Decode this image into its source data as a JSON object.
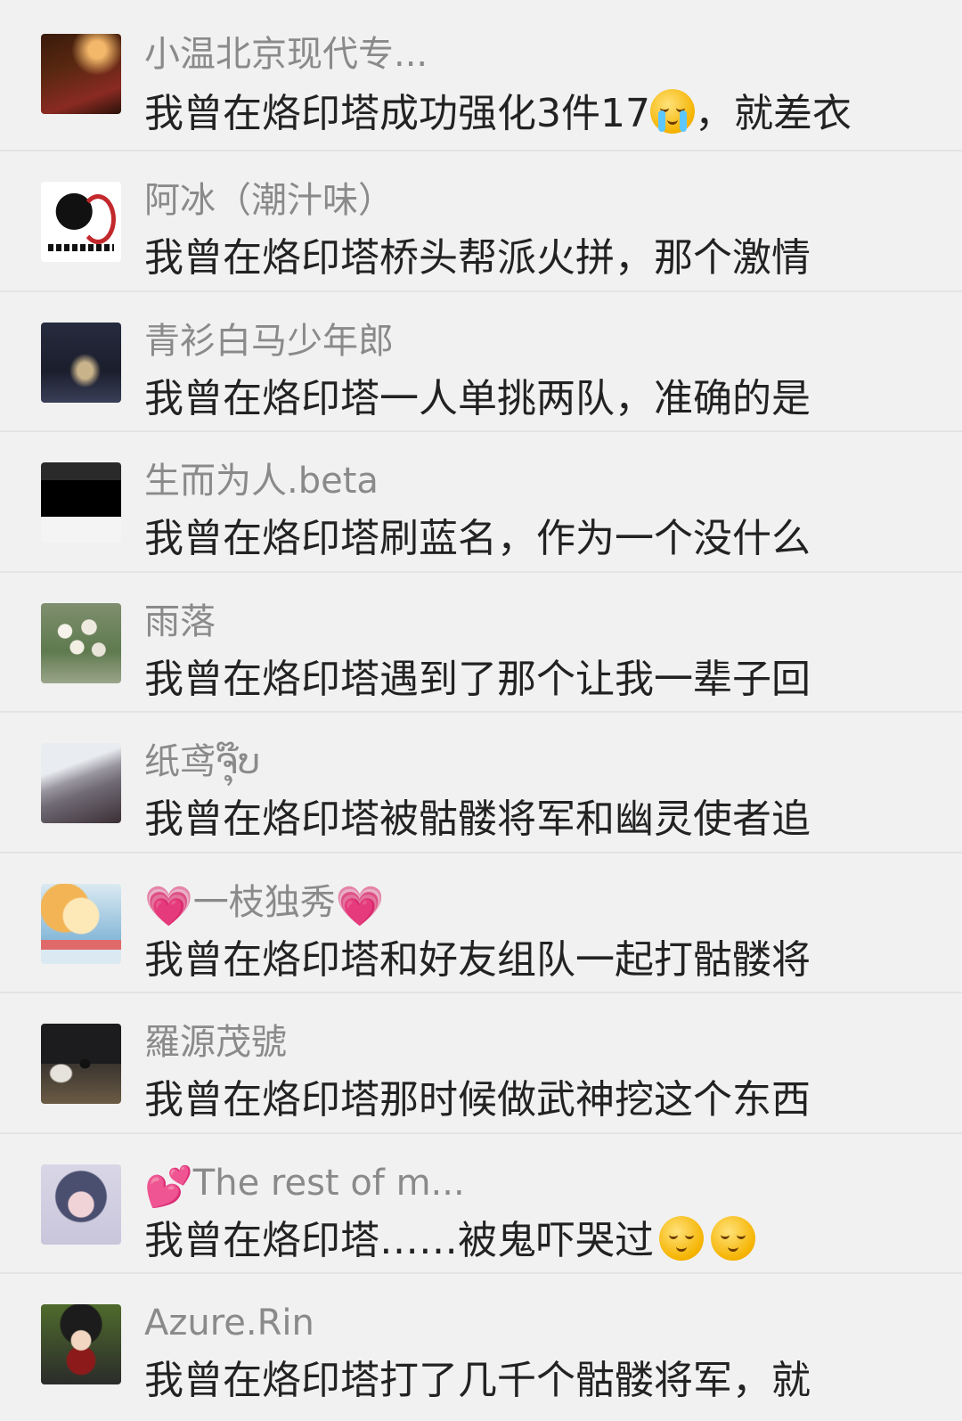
{
  "comments": [
    {
      "name": "小温北京现代专...",
      "message": "我曾在烙印塔成功强化3件17",
      "message_tail": "，就差衣",
      "avatar_colors": [
        "#5a2810",
        "#c8742c",
        "#8a2a22"
      ]
    },
    {
      "name": "阿冰（潮汁味）",
      "message": "我曾在烙印塔桥头帮派火拼，那个激情",
      "avatar_colors": [
        "#ffffff",
        "#c2282c",
        "#111111"
      ]
    },
    {
      "name": "青衫白马少年郎",
      "message": "我曾在烙印塔一人单挑两队，准确的是",
      "avatar_colors": [
        "#1b1e2c",
        "#3a3f58",
        "#b8a27a"
      ]
    },
    {
      "name": "生而为人.beta",
      "message": "我曾在烙印塔刷蓝名，作为一个没什么",
      "avatar_colors": [
        "#f4f4f4",
        "#000000",
        "#2a2a2a"
      ]
    },
    {
      "name": "雨落",
      "message": "我曾在烙印塔遇到了那个让我一辈子回",
      "avatar_colors": [
        "#9aa58a",
        "#e8e4d8",
        "#5f7a4f"
      ]
    },
    {
      "name": "纸鸢ຈຸ໊ບ",
      "message": "我曾在烙印塔被骷髅将军和幽灵使者追",
      "avatar_colors": [
        "#d9dde4",
        "#6f6a74",
        "#3c2f35"
      ]
    },
    {
      "name_prefix_icon": "heart-icon",
      "name": "一枝独秀",
      "name_suffix_icon": "heart-icon",
      "message": "我曾在烙印塔和好友组队一起打骷髅将",
      "avatar_colors": [
        "#fde8b8",
        "#f3b455",
        "#86b8d8"
      ]
    },
    {
      "name": "羅源茂號",
      "message": "我曾在烙印塔那时候做武神挖这个东西",
      "avatar_colors": [
        "#1c1c1e",
        "#6b5b45",
        "#d8d3c8"
      ]
    },
    {
      "name_prefix_icon": "two-hearts-icon",
      "name": "The rest of m...",
      "message": "我曾在烙印塔……被鬼吓哭过",
      "avatar_colors": [
        "#c9c6dc",
        "#4a4f70",
        "#f0d3d6"
      ]
    },
    {
      "name": "Azure.Rin",
      "message": "我曾在烙印塔打了几千个骷髅将军，就",
      "avatar_colors": [
        "#2b2b2b",
        "#8c1a1a",
        "#4f6b2c"
      ]
    }
  ]
}
